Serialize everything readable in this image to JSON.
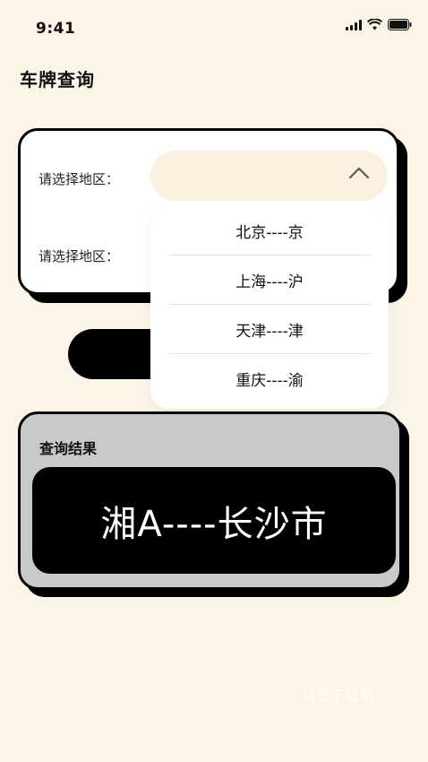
{
  "status_bar": {
    "time": "9:41"
  },
  "page": {
    "title": "车牌查询"
  },
  "query_form": {
    "region_label_1": "请选择地区：",
    "region_label_2": "请选择地区："
  },
  "dropdown": {
    "options": [
      "北京----京",
      "上海----沪",
      "天津----津",
      "重庆----渝"
    ]
  },
  "result": {
    "title": "查询结果",
    "plate_text": "湘A----长沙市"
  },
  "watermark": {
    "text": "哇哥下载站"
  },
  "icons": {
    "signal": "signal-icon",
    "wifi": "wifi-icon",
    "battery": "battery-icon",
    "select_toggle": "chevron-up-icon"
  },
  "colors": {
    "background": "#fdf4e8",
    "select_background": "#fbefe0",
    "result_card": "#c9c9c9",
    "accent_dark": "#000000"
  }
}
